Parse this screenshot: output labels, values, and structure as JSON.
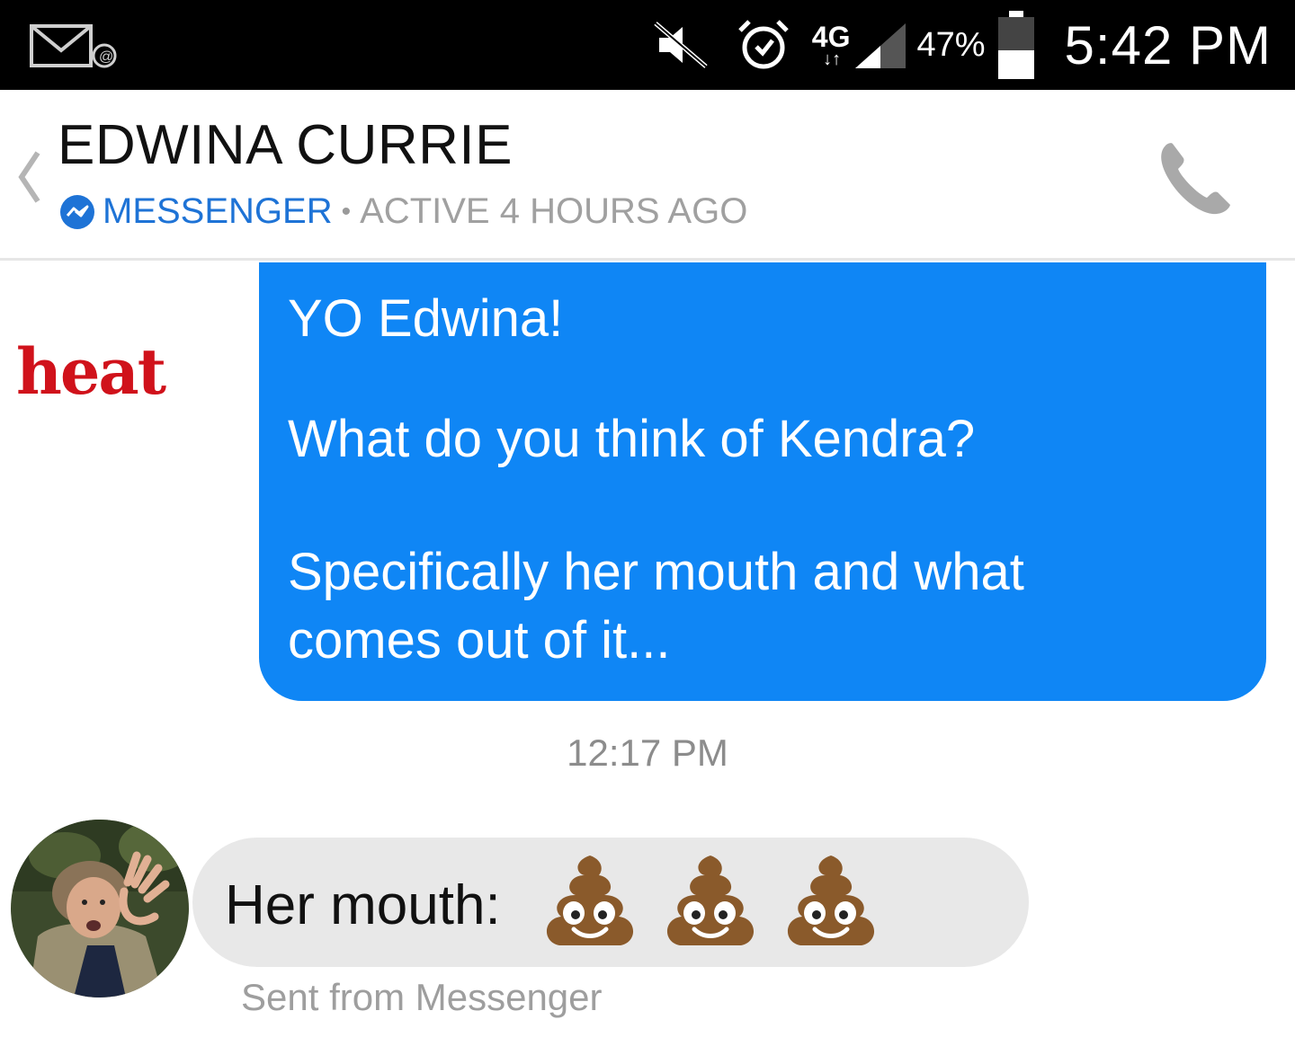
{
  "status_bar": {
    "icons": [
      "mail-notification-icon",
      "mute-icon",
      "alarm-icon",
      "signal-icon",
      "battery-icon"
    ],
    "network": "4G",
    "network_arrows": "↓↑",
    "battery_percent": "47%",
    "battery_level": 0.47,
    "time": "5:42 PM"
  },
  "header": {
    "contact_name": "EDWINA CURRIE",
    "messenger_label": "MESSENGER",
    "separator": "•",
    "active_status": "ACTIVE 4 HOURS AGO"
  },
  "watermark": "heat",
  "messages": {
    "outgoing": {
      "lines": [
        "YO Edwina!",
        "What do you think of Kendra?",
        "Specifically her mouth and what",
        "comes out of it..."
      ]
    },
    "timestamp": "12:17 PM",
    "incoming": {
      "text": "Her mouth:",
      "emoji": [
        "pile-of-poo",
        "pile-of-poo",
        "pile-of-poo"
      ]
    },
    "sent_from": "Sent from Messenger"
  },
  "colors": {
    "outgoing_bubble": "#0f86f5",
    "incoming_bubble": "#e8e8e8",
    "messenger_blue": "#1e73d6",
    "watermark_red": "#d0121b"
  }
}
